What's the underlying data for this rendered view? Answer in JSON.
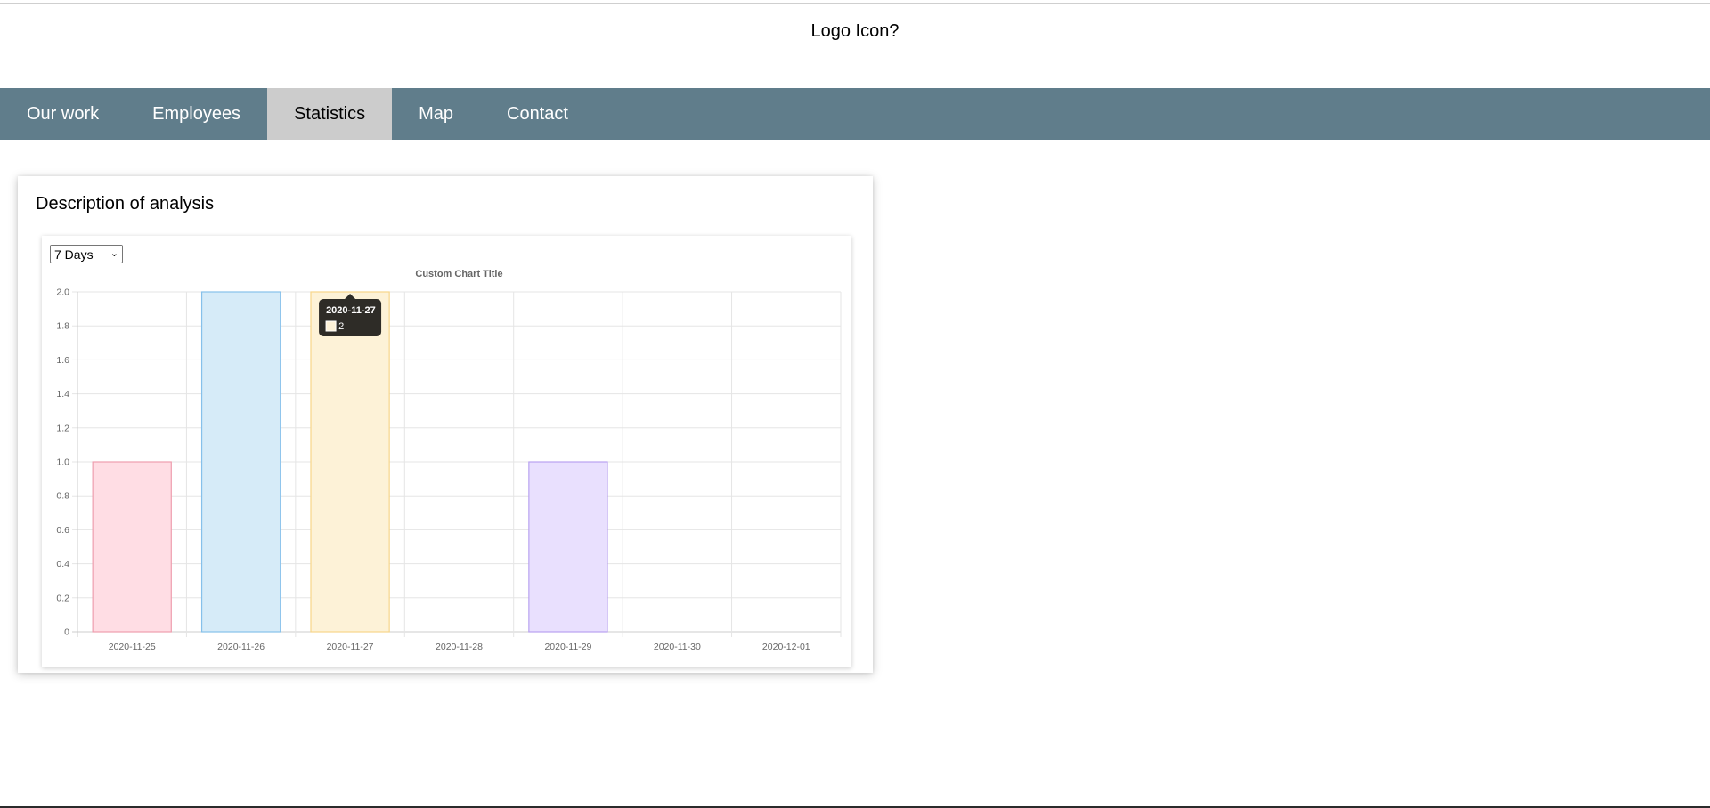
{
  "header": {
    "logo_text": "Logo Icon?"
  },
  "nav": {
    "bar_color": "#607d8b",
    "active_color": "#cccccc",
    "active_index": 2,
    "items": [
      {
        "label": "Our work"
      },
      {
        "label": "Employees"
      },
      {
        "label": "Statistics"
      },
      {
        "label": "Map"
      },
      {
        "label": "Contact"
      }
    ]
  },
  "card": {
    "title": "Description of analysis",
    "range_select": {
      "selected": "7 Days"
    }
  },
  "tooltip": {
    "title": "2020-11-27",
    "value": "2",
    "category_index": 2
  },
  "chart_data": {
    "type": "bar",
    "title": "Custom Chart Title",
    "xlabel": "",
    "ylabel": "",
    "ylim": [
      0,
      2
    ],
    "yticks": [
      "2.0",
      "1.8",
      "1.6",
      "1.4",
      "1.2",
      "1.0",
      "0.8",
      "0.6",
      "0.4",
      "0.2",
      "0"
    ],
    "categories": [
      "2020-11-25",
      "2020-11-26",
      "2020-11-27",
      "2020-11-28",
      "2020-11-29",
      "2020-11-30",
      "2020-12-01"
    ],
    "values": [
      1,
      2,
      2,
      0,
      1,
      0,
      0
    ],
    "bar_fill_colors": [
      "#ffdde4",
      "#d6ebf8",
      "#fdf2d7",
      "#dff3f3",
      "#e9e0fe",
      "#ffe9d4",
      "#eeeeee"
    ],
    "bar_border_colors": [
      "#ee9eae",
      "#86c0ea",
      "#f7d68a",
      "#7fcfcf",
      "#b9a2f0",
      "#ffb56e",
      "#c9cbcf"
    ],
    "grid": true,
    "legend": "none"
  }
}
